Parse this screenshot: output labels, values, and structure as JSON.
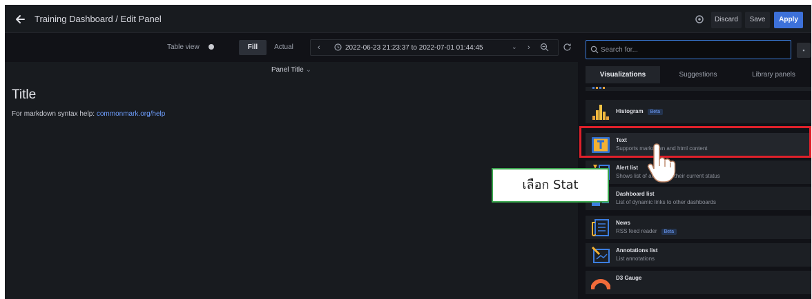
{
  "header": {
    "breadcrumb": "Training Dashboard / Edit Panel",
    "discard_label": "Discard",
    "save_label": "Save",
    "apply_label": "Apply"
  },
  "toolbar": {
    "table_view_label": "Table view",
    "fill_label": "Fill",
    "actual_label": "Actual",
    "time_range": "2022-06-23 21:23:37 to 2022-07-01 01:44:45"
  },
  "panel": {
    "title": "Panel Title",
    "content_title": "Title",
    "help_prefix": "For markdown syntax help:",
    "help_link": "commonmark.org/help"
  },
  "right_pane": {
    "search_placeholder": "Search for...",
    "tabs": [
      "Visualizations",
      "Suggestions",
      "Library panels"
    ],
    "items": [
      {
        "name": "Histogram",
        "badge": "Beta",
        "desc": ""
      },
      {
        "name": "Text",
        "badge": "",
        "desc": "Supports markdown and html content"
      },
      {
        "name": "Alert list",
        "badge": "",
        "desc": "Shows list of alerts and their current status"
      },
      {
        "name": "Dashboard list",
        "badge": "",
        "desc": "List of dynamic links to other dashboards"
      },
      {
        "name": "News",
        "badge": "Beta",
        "desc": "RSS feed reader"
      },
      {
        "name": "Annotations list",
        "badge": "",
        "desc": "List annotations"
      },
      {
        "name": "D3 Gauge",
        "badge": "",
        "desc": ""
      }
    ]
  },
  "callout": {
    "text": "เลือก Stat"
  },
  "colors": {
    "accent": "#3d71d9",
    "highlight": "#e0202a",
    "callout_border": "#3aa84e"
  }
}
